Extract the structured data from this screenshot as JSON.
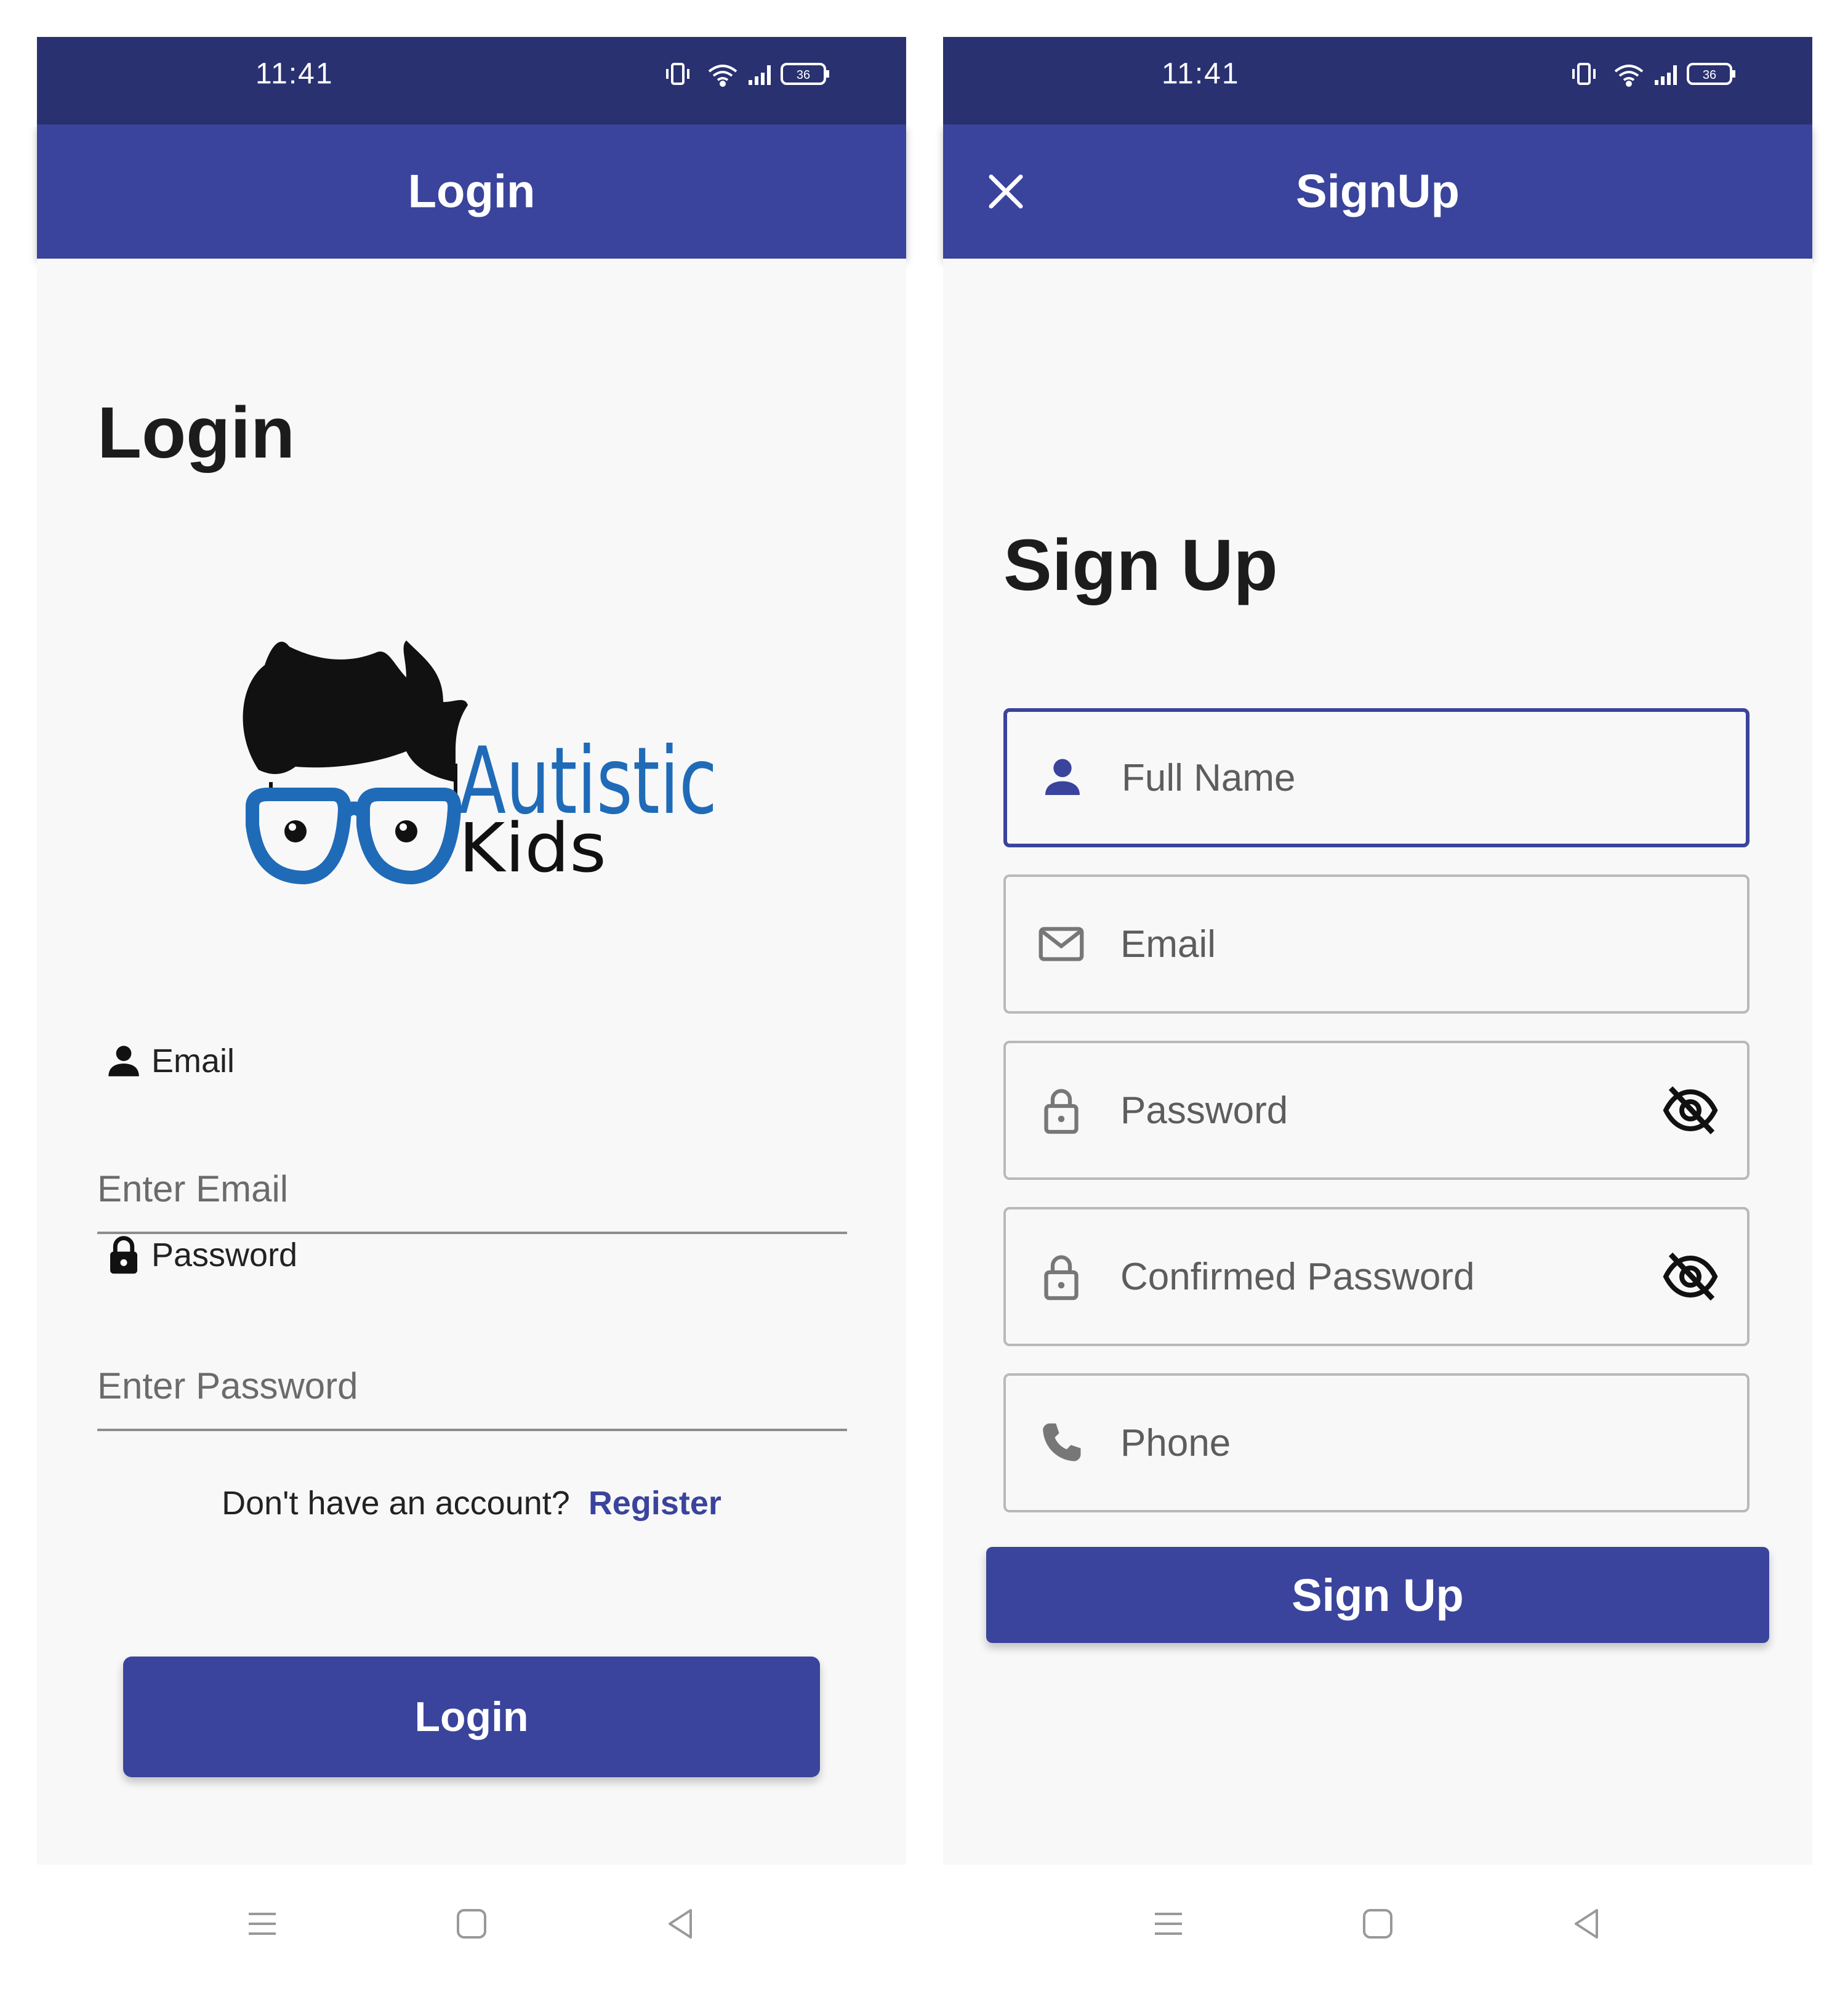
{
  "status_bar": {
    "time": "11:41",
    "battery": "36"
  },
  "login": {
    "appbar_title": "Login",
    "page_title": "Login",
    "logo": {
      "brand_word1": "Autistic",
      "brand_word2": "Kids"
    },
    "email_label": "Email",
    "email_placeholder": "Enter Email",
    "password_label": "Password",
    "password_placeholder": "Enter Password",
    "no_account_text": "Don't have an account?",
    "register_link": "Register",
    "login_button": "Login"
  },
  "signup": {
    "appbar_title": "SignUp",
    "page_title": "Sign Up",
    "fields": {
      "full_name": "Full Name",
      "email": "Email",
      "password": "Password",
      "confirm_password": "Confirmed Password",
      "phone": "Phone"
    },
    "signup_button": "Sign Up"
  },
  "colors": {
    "status_bar": "#293170",
    "primary": "#3a449c",
    "background": "#f8f8f8",
    "logo_blue": "#1f6bb8"
  },
  "icons": {
    "status": [
      "vibrate-icon",
      "wifi-icon",
      "signal-icon",
      "battery-icon"
    ],
    "nav": [
      "menu-icon",
      "home-icon",
      "back-icon"
    ]
  }
}
